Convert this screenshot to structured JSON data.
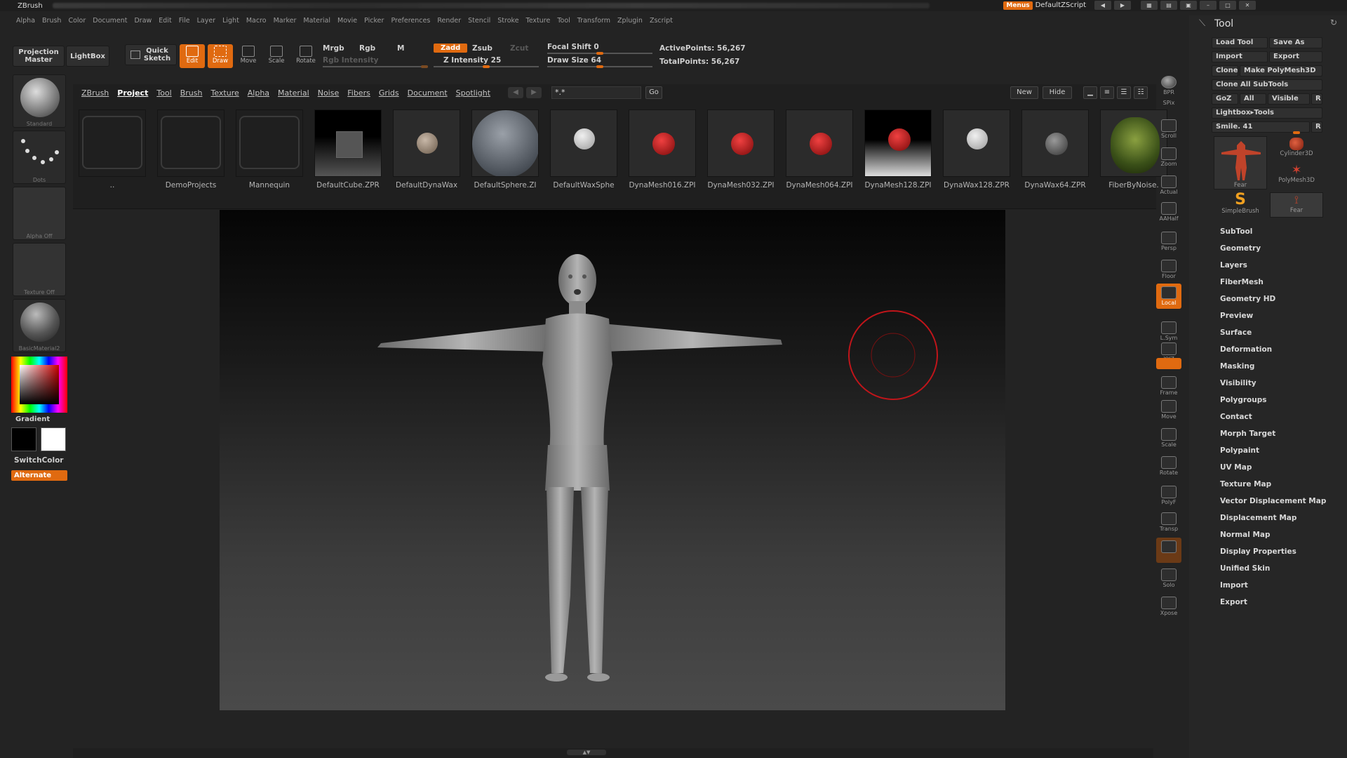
{
  "title_bar": {
    "app": "ZBrush",
    "menus_button": "Menus",
    "script": "DefaultZScript"
  },
  "menu_bar": [
    "Alpha",
    "Brush",
    "Color",
    "Document",
    "Draw",
    "Edit",
    "File",
    "Layer",
    "Light",
    "Macro",
    "Marker",
    "Material",
    "Movie",
    "Picker",
    "Preferences",
    "Render",
    "Stencil",
    "Stroke",
    "Texture",
    "Tool",
    "Transform",
    "Zplugin",
    "Zscript"
  ],
  "shelf": {
    "projection_master": "Projection Master",
    "lightbox": "LightBox",
    "quick_sketch": "Quick Sketch",
    "modes": [
      "Edit",
      "Draw",
      "Move",
      "Scale",
      "Rotate"
    ],
    "mrgb": "Mrgb",
    "rgb": "Rgb",
    "m": "M",
    "rgb_intensity": "Rgb Intensity",
    "zadd": "Zadd",
    "zsub": "Zsub",
    "zcut": "Zcut",
    "z_intensity": "Z Intensity 25",
    "focal_shift": "Focal Shift 0",
    "draw_size": "Draw Size 64",
    "active_points": "ActivePoints: 56,267",
    "total_points": "TotalPoints: 56,267",
    "z_intensity_value": 25,
    "draw_size_value": 64,
    "focal_shift_value": 0
  },
  "left_column": {
    "brush": "Standard",
    "stroke": "Dots",
    "alpha": "Alpha Off",
    "texture": "Texture Off",
    "material": "BasicMaterial2",
    "gradient": "Gradient",
    "switch_color": "SwitchColor",
    "alternate": "Alternate"
  },
  "lightbox": {
    "tabs": [
      "ZBrush",
      "Project",
      "Tool",
      "Brush",
      "Texture",
      "Alpha",
      "Material",
      "Noise",
      "Fibers",
      "Grids",
      "Document",
      "Spotlight"
    ],
    "active_tab": "Project",
    "search_value": "*.*",
    "go": "Go",
    "new": "New",
    "hide": "Hide",
    "items": [
      {
        "name": "..",
        "kind": "folder"
      },
      {
        "name": "DemoProjects",
        "kind": "folder"
      },
      {
        "name": "Mannequin",
        "kind": "folder"
      },
      {
        "name": "DefaultCube.ZPR",
        "kind": "cube"
      },
      {
        "name": "DefaultDynaWax",
        "kind": "tan"
      },
      {
        "name": "DefaultSphere.ZI",
        "kind": "bigsphere"
      },
      {
        "name": "DefaultWaxSphe",
        "kind": "white"
      },
      {
        "name": "DynaMesh016.ZPI",
        "kind": "red"
      },
      {
        "name": "DynaMesh032.ZPI",
        "kind": "red"
      },
      {
        "name": "DynaMesh064.ZPI",
        "kind": "red"
      },
      {
        "name": "DynaMesh128.ZPI",
        "kind": "redgrad"
      },
      {
        "name": "DynaWax128.ZPR",
        "kind": "white"
      },
      {
        "name": "DynaWax64.ZPR",
        "kind": "grey"
      },
      {
        "name": "FiberByNoise.",
        "kind": "fiber"
      }
    ]
  },
  "right_shelf": [
    "BPR",
    "SPix",
    "Scroll",
    "Zoom",
    "Actual",
    "AAHalf",
    "Persp",
    "Floor",
    "Local",
    "L.Sym",
    "XYZ",
    "",
    "Frame",
    "Move",
    "Scale",
    "Rotate",
    "PolyF",
    "Transp",
    "",
    "Solo",
    "Xpose"
  ],
  "tool_palette": {
    "title": "Tool",
    "load_tool": "Load Tool",
    "save_as": "Save As",
    "import": "Import",
    "export": "Export",
    "clone": "Clone",
    "make_polymesh": "Make PolyMesh3D",
    "clone_all": "Clone All SubTools",
    "goz": "GoZ",
    "all": "All",
    "visible": "Visible",
    "r": "R",
    "lightbox_tools": "Lightbox▸Tools",
    "current_tool": "Smile. 41",
    "thumbs": {
      "main": "Fear",
      "cyl": "Cylinder3D",
      "poly": "PolyMesh3D",
      "simple": "SimpleBrush",
      "fear": "Fear"
    },
    "sections": [
      "SubTool",
      "Geometry",
      "Layers",
      "FiberMesh",
      "Geometry HD",
      "Preview",
      "Surface",
      "Deformation",
      "Masking",
      "Visibility",
      "Polygroups",
      "Contact",
      "Morph Target",
      "Polypaint",
      "UV Map",
      "Texture Map",
      "Vector Displacement Map",
      "Displacement Map",
      "Normal Map",
      "Display Properties",
      "Unified Skin",
      "Import",
      "Export"
    ]
  },
  "colors": {
    "accent": "#e06a10",
    "bg": "#232323"
  }
}
